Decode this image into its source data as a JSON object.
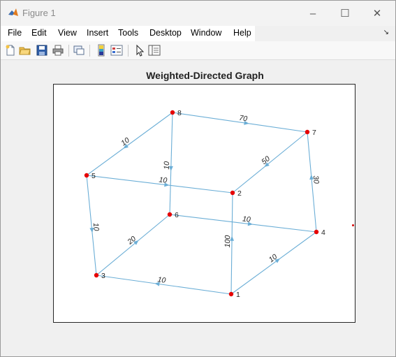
{
  "window": {
    "title": "Figure 1",
    "controls": {
      "minimize": "–",
      "maximize": "☐",
      "close": "✕"
    }
  },
  "menu": {
    "items": [
      "File",
      "Edit",
      "View",
      "Insert",
      "Tools",
      "Desktop",
      "Window",
      "Help"
    ],
    "dock_icon": "dock-arrow-icon"
  },
  "toolbar": {
    "buttons": [
      "new-figure-icon",
      "open-file-icon",
      "save-icon",
      "print-icon",
      "link-plot-icon",
      "colorbar-icon",
      "legend-icon",
      "edit-plot-pointer-icon",
      "property-inspector-icon"
    ]
  },
  "colors": {
    "edge": "#6baed6",
    "node": "#e60000",
    "axes_border": "#262626"
  },
  "chart_data": {
    "type": "graph",
    "title": "Weighted-Directed Graph",
    "nodes": [
      "1",
      "2",
      "3",
      "4",
      "5",
      "6",
      "7",
      "8"
    ],
    "edges": [
      {
        "source": "8",
        "target": "7",
        "weight": "70"
      },
      {
        "source": "8",
        "target": "5",
        "weight": "10"
      },
      {
        "source": "8",
        "target": "6",
        "weight": "10"
      },
      {
        "source": "7",
        "target": "2",
        "weight": "50"
      },
      {
        "source": "4",
        "target": "7",
        "weight": "30"
      },
      {
        "source": "5",
        "target": "2",
        "weight": "10"
      },
      {
        "source": "5",
        "target": "3",
        "weight": "10"
      },
      {
        "source": "6",
        "target": "4",
        "weight": "10"
      },
      {
        "source": "3",
        "target": "6",
        "weight": "20"
      },
      {
        "source": "1",
        "target": "2",
        "weight": "100"
      },
      {
        "source": "1",
        "target": "4",
        "weight": "10"
      },
      {
        "source": "1",
        "target": "3",
        "weight": "10"
      }
    ]
  }
}
